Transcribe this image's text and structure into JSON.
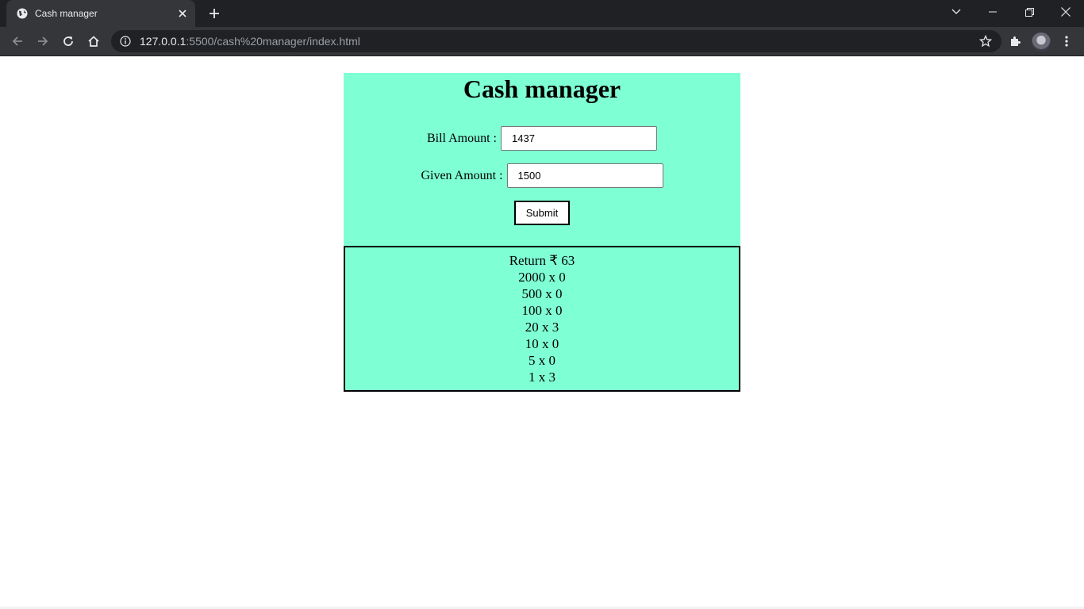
{
  "browser": {
    "tab_title": "Cash manager",
    "url_host": "127.0.0.1",
    "url_rest": ":5500/cash%20manager/index.html"
  },
  "page": {
    "title": "Cash manager",
    "bill_label": "Bill Amount :",
    "bill_value": "1437",
    "given_label": "Given Amount :",
    "given_value": "1500",
    "submit_label": "Submit",
    "output": [
      "Return ₹ 63",
      "2000 x 0",
      "500 x 0",
      "100 x 0",
      "20 x 3",
      "10 x 0",
      "5 x 0",
      "1 x 3"
    ]
  },
  "colors": {
    "card_bg": "#7fffd4",
    "chrome_dark": "#202124",
    "chrome_toolbar": "#35363a"
  },
  "icons": [
    "globe-icon",
    "close-icon",
    "plus-icon",
    "chevron-down-icon",
    "minimize-icon",
    "restore-icon",
    "back-icon",
    "forward-icon",
    "reload-icon",
    "home-icon",
    "info-icon",
    "star-icon",
    "extensions-icon",
    "menu-icon"
  ]
}
